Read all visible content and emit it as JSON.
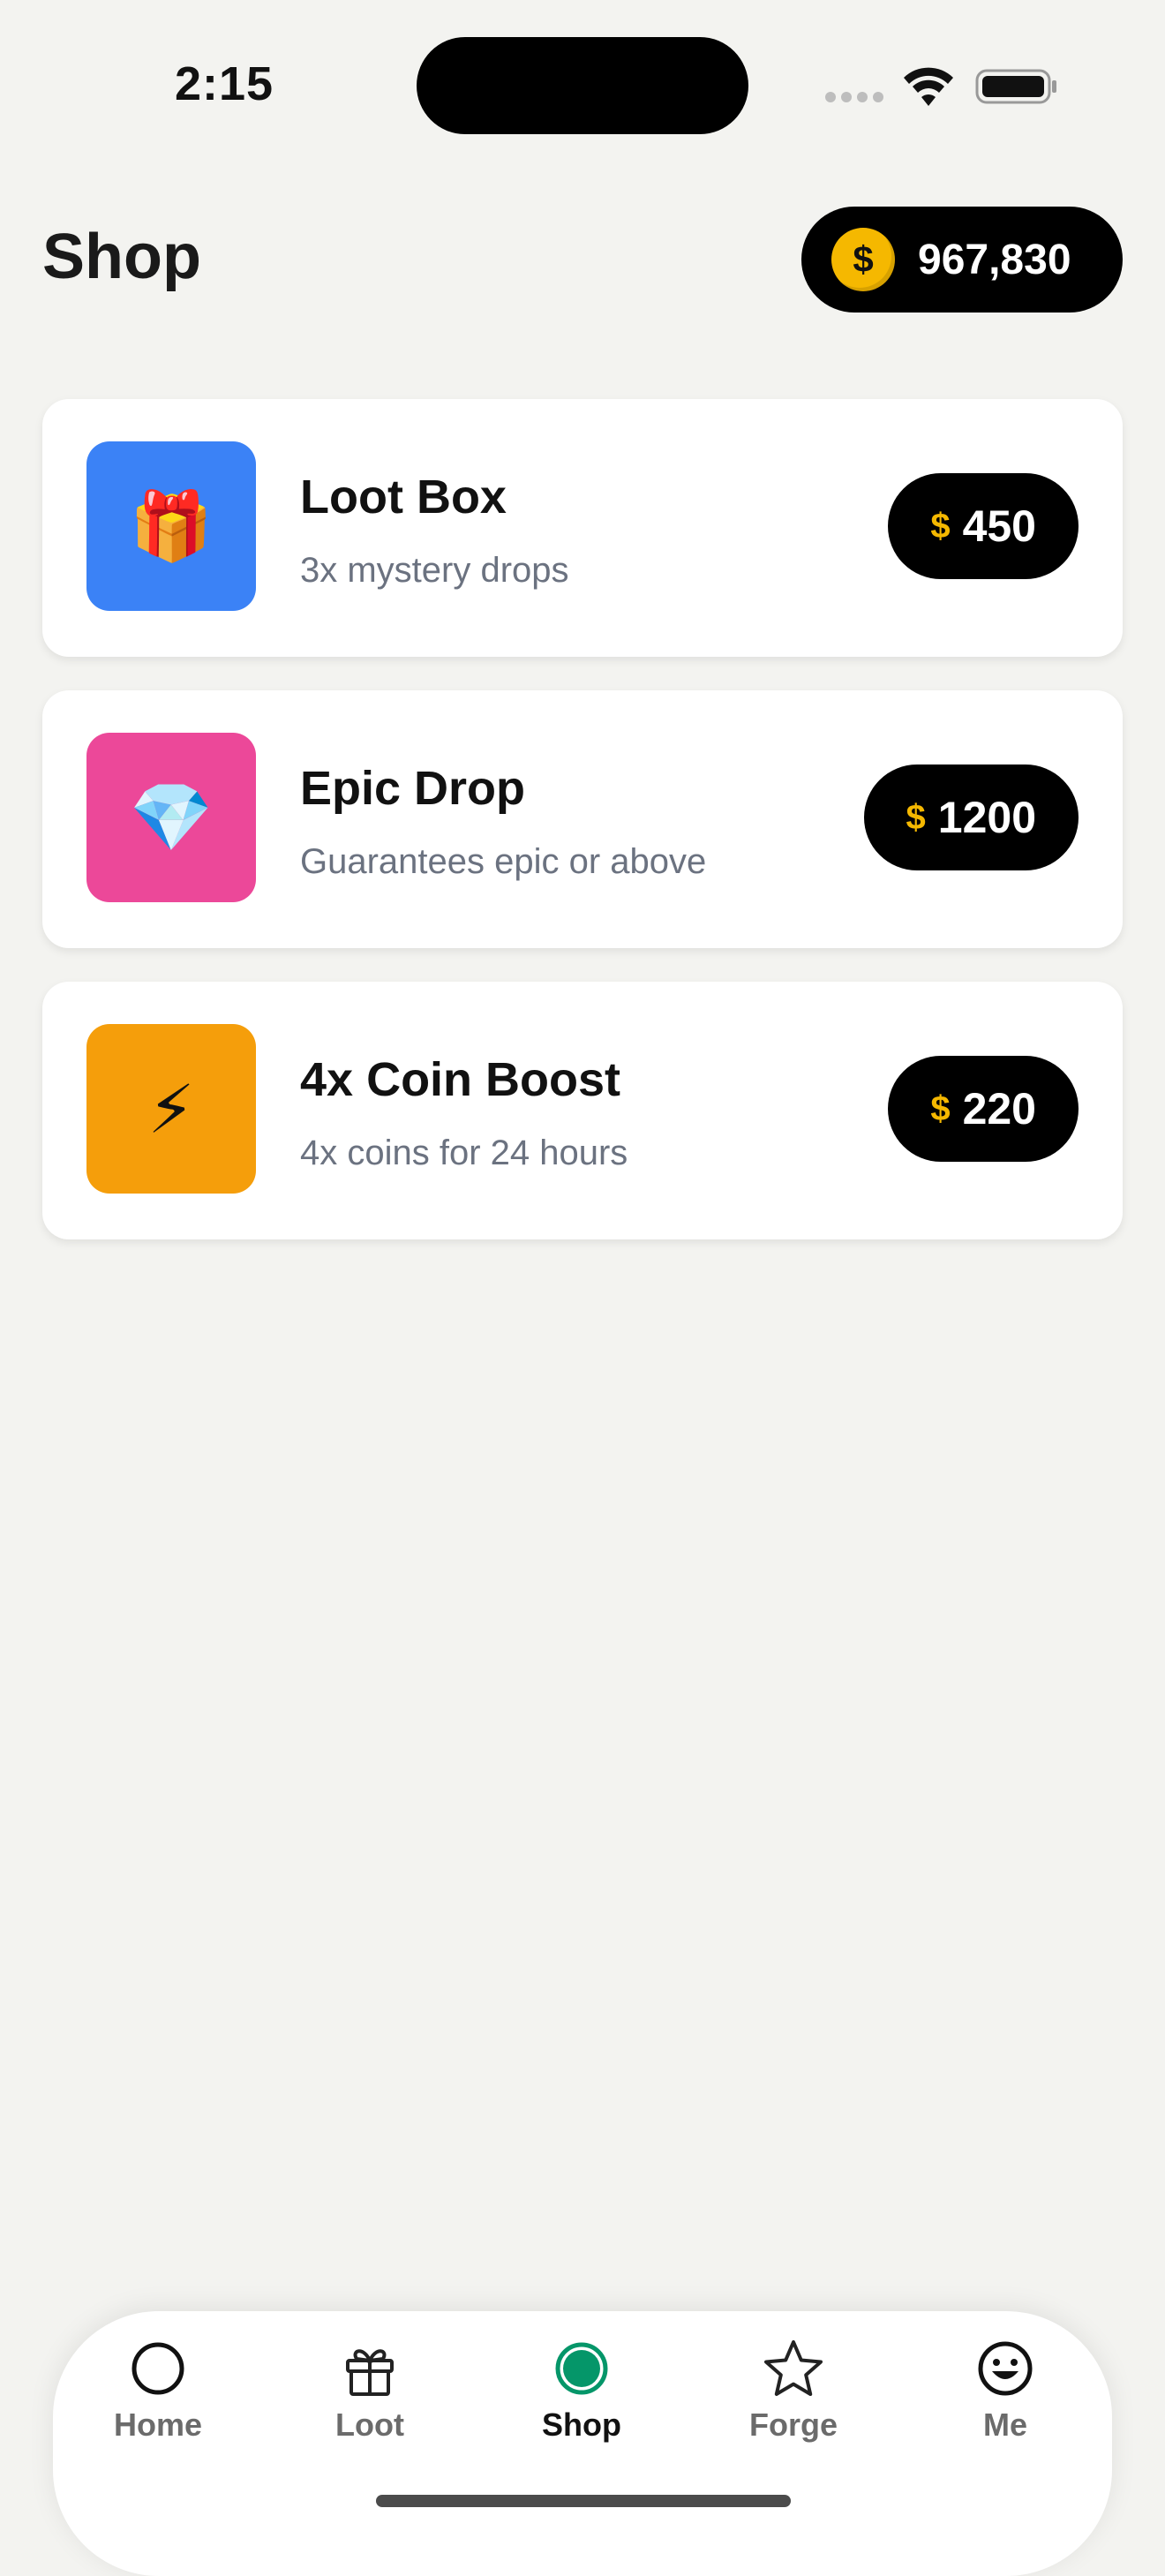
{
  "status_bar": {
    "time": "2:15"
  },
  "header": {
    "title": "Shop",
    "coin_symbol": "$",
    "balance": "967,830"
  },
  "items": [
    {
      "title": "Loot Box",
      "subtitle": "3x mystery drops",
      "price_symbol": "$",
      "price": "450",
      "icon": "gift-icon",
      "thumb_color": "#3b82f6",
      "glyph": "🎁"
    },
    {
      "title": "Epic Drop",
      "subtitle": "Guarantees epic or above",
      "price_symbol": "$",
      "price": "1200",
      "icon": "diamond-icon",
      "thumb_color": "#ec4899",
      "glyph": "💎"
    },
    {
      "title": "4x Coin Boost",
      "subtitle": "4x coins for 24 hours",
      "price_symbol": "$",
      "price": "220",
      "icon": "lightning-icon",
      "thumb_color": "#f59e0b",
      "glyph": "⚡"
    }
  ],
  "tab_bar": {
    "tabs": [
      {
        "label": "Home",
        "icon": "circle-icon",
        "active": false
      },
      {
        "label": "Loot",
        "icon": "gift-icon",
        "active": false
      },
      {
        "label": "Shop",
        "icon": "shop-dot-icon",
        "active": true
      },
      {
        "label": "Forge",
        "icon": "star-icon",
        "active": false
      },
      {
        "label": "Me",
        "icon": "smiley-icon",
        "active": false
      }
    ]
  },
  "colors": {
    "background": "#f3f3f0",
    "accent_coin": "#f5b800",
    "active_tab": "#059669",
    "pill": "#000000"
  }
}
